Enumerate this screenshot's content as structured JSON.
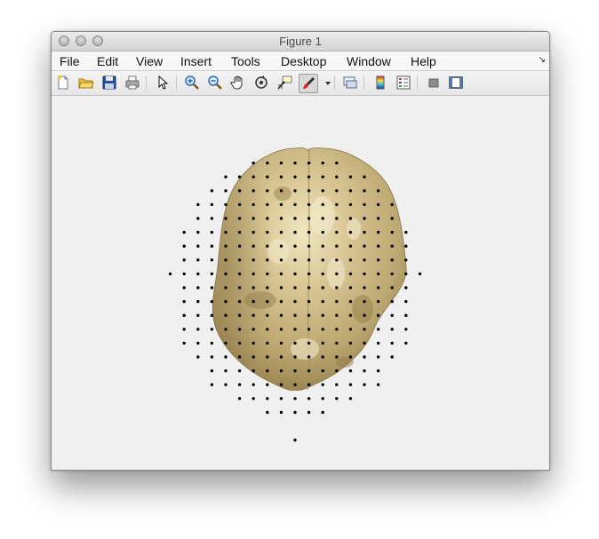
{
  "window": {
    "title": "Figure 1"
  },
  "menubar": {
    "items": [
      "File",
      "Edit",
      "View",
      "Insert",
      "Tools",
      "Desktop",
      "Window",
      "Help"
    ]
  },
  "toolbar": {
    "buttons": [
      "new-figure-icon",
      "open-file-icon",
      "save-icon",
      "print-icon",
      "edit-plot-pointer-icon",
      "zoom-in-icon",
      "zoom-out-icon",
      "pan-hand-icon",
      "rotate-3d-icon",
      "data-cursor-icon",
      "brush-icon",
      "brush-dropdown-icon",
      "link-plot-icon",
      "insert-colorbar-icon",
      "insert-legend-icon",
      "hide-plot-tools-icon",
      "show-plot-tools-icon"
    ],
    "pressed": "brush-icon"
  },
  "colors": {
    "figure_background": "#f0f0f0",
    "surface_base": "#c8b483",
    "surface_highlight": "#efe3b8",
    "markers": "#000000"
  }
}
